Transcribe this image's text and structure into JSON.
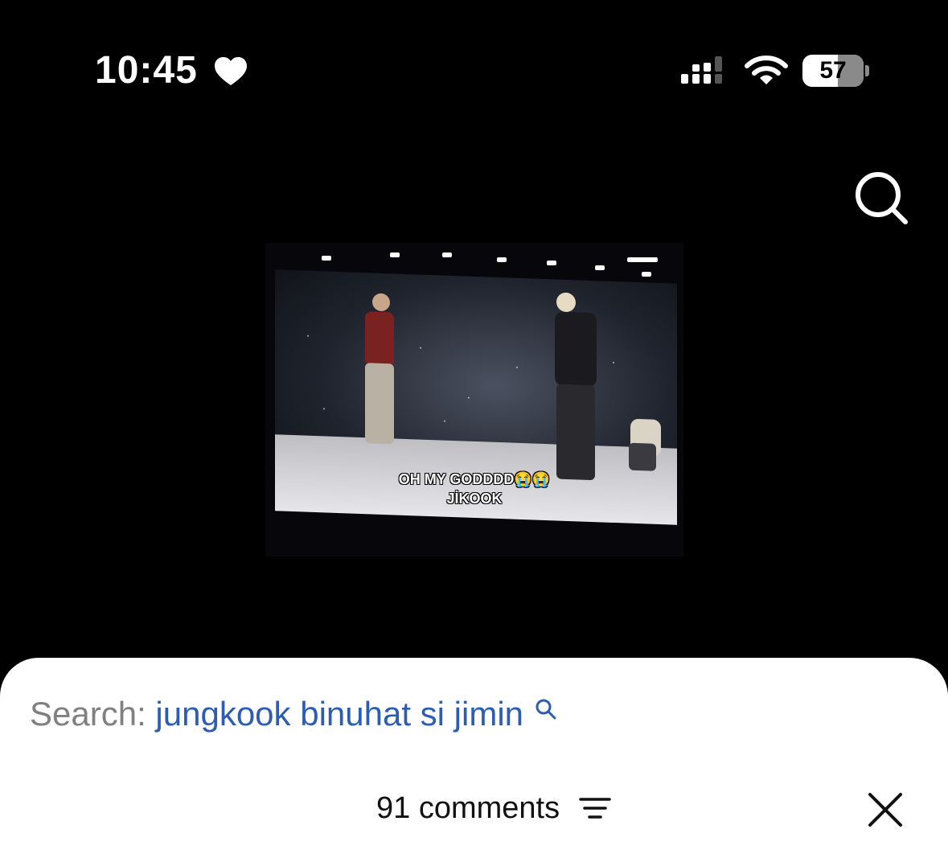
{
  "status_bar": {
    "time": "10:45",
    "battery_level": "57",
    "icons": [
      "heart-icon",
      "signal-icon",
      "wifi-icon",
      "battery-icon"
    ]
  },
  "header": {
    "search_icon": "search-icon"
  },
  "video": {
    "caption_line1": "OH MY GODDDD😭😭",
    "caption_line2": "JİKOOK"
  },
  "comments_sheet": {
    "search_label": "Search:",
    "search_query": "jungkook binuhat si jimin",
    "comments_count": "91 comments",
    "sort_icon": "sort-icon",
    "close_icon": "close-icon"
  },
  "colors": {
    "background": "#000000",
    "sheet": "#ffffff",
    "link": "#2d5db3",
    "label_gray": "#808080"
  }
}
